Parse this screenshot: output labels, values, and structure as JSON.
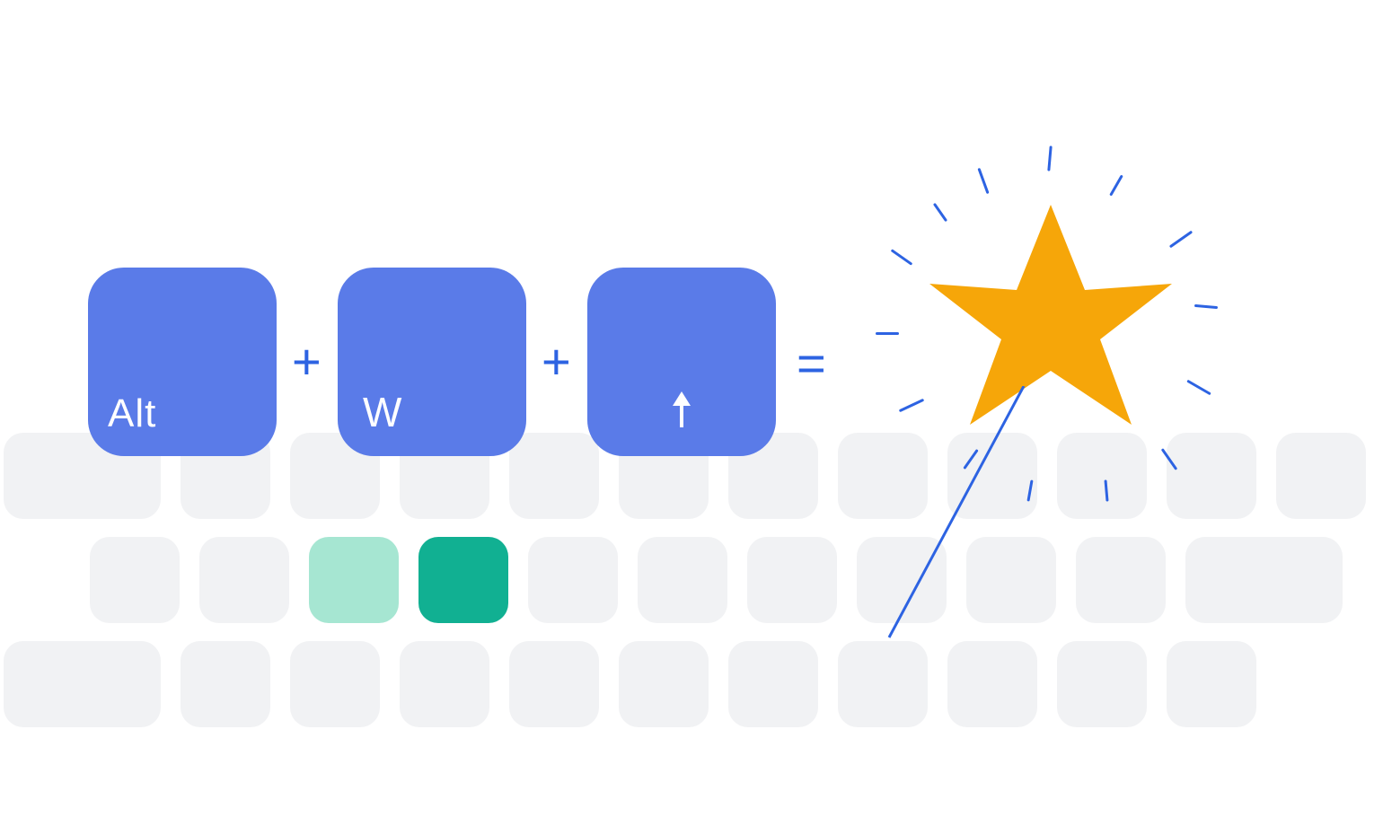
{
  "shortcut": {
    "key1": "Alt",
    "key2": "W",
    "key3_is_up_arrow": true,
    "op_plus": "+",
    "op_equals": "="
  },
  "colors": {
    "blue_key": "#5a7be8",
    "blue_accent": "#2d63e2",
    "teal_light": "#a6e6d2",
    "teal_dark": "#11b092",
    "grey_key": "#f1f2f4",
    "star": "#f6a609"
  },
  "keyboard": {
    "row1_count": 12,
    "row1_first_wide": true,
    "row2_count": 11,
    "row2_highlight_light_index": 2,
    "row2_highlight_dark_index": 3,
    "row2_last_wide": true,
    "row3_count": 11,
    "row3_first_wide": true
  },
  "icon_names": {
    "star": "star-icon",
    "wand": "magic-wand-icon",
    "up_arrow": "up-arrow-icon"
  }
}
